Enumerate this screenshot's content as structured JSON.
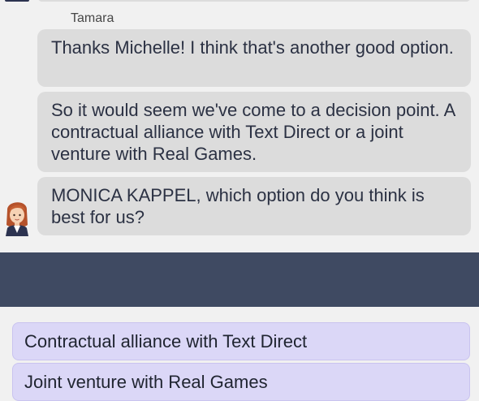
{
  "chat": {
    "sender": "Tamara",
    "messages": [
      "Thanks Michelle! I think that's another good option.",
      "So it would seem we've come to a decision point. A contractual alliance with Text Direct or a joint venture with Real Games.",
      "MONICA KAPPEL, which option do you think is best for us?"
    ]
  },
  "options": [
    "Contractual alliance with Text Direct",
    "Joint venture with Real Games"
  ],
  "colors": {
    "bubble": "#dcdcdc",
    "divider_bar": "#3f4a62",
    "option_bg": "#dbd7f7",
    "text": "#2b3143"
  }
}
